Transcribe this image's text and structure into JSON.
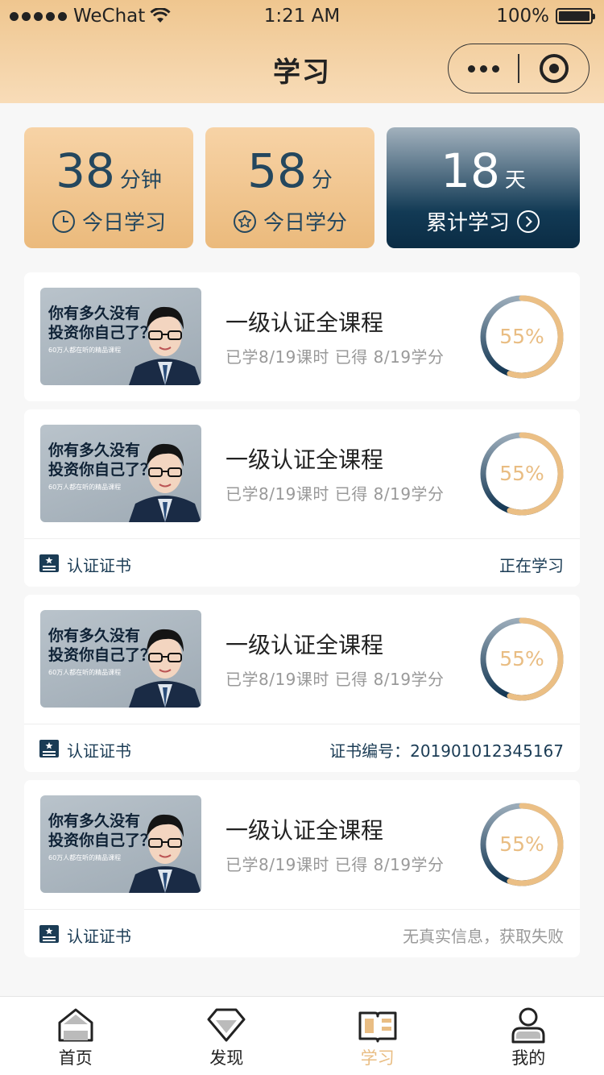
{
  "status_bar": {
    "carrier": "WeChat",
    "time": "1:21 AM",
    "battery": "100%"
  },
  "nav": {
    "title": "学习"
  },
  "stats": [
    {
      "value": "38",
      "unit": "分钟",
      "label": "今日学习",
      "icon": "clock-icon"
    },
    {
      "value": "58",
      "unit": "分",
      "label": "今日学分",
      "icon": "star-icon"
    },
    {
      "value": "18",
      "unit": "天",
      "label": "累计学习",
      "icon": "chevron-right-circle-icon"
    }
  ],
  "courses": [
    {
      "thumb_title_1": "你有多久没有",
      "thumb_title_2": "投资你自己了？",
      "thumb_sub": "60万人都在听的精品课程",
      "title": "一级认证全课程",
      "meta": "已学8/19课时 已得 8/19学分",
      "progress": 0.55,
      "progress_label": "55%"
    },
    {
      "thumb_title_1": "你有多久没有",
      "thumb_title_2": "投资你自己了？",
      "thumb_sub": "60万人都在听的精品课程",
      "title": "一级认证全课程",
      "meta": "已学8/19课时 已得 8/19学分",
      "progress": 0.55,
      "progress_label": "55%",
      "cert_label": "认证证书",
      "cert_status": "正在学习"
    },
    {
      "thumb_title_1": "你有多久没有",
      "thumb_title_2": "投资你自己了？",
      "thumb_sub": "60万人都在听的精品课程",
      "title": "一级认证全课程",
      "meta": "已学8/19课时 已得 8/19学分",
      "progress": 0.55,
      "progress_label": "55%",
      "cert_label": "认证证书",
      "cert_status": "证书编号：201901012345167"
    },
    {
      "thumb_title_1": "你有多久没有",
      "thumb_title_2": "投资你自己了？",
      "thumb_sub": "60万人都在听的精品课程",
      "title": "一级认证全课程",
      "meta": "已学8/19课时 已得 8/19学分",
      "progress": 0.55,
      "progress_label": "55%",
      "cert_label": "认证证书",
      "cert_status": "无真实信息，获取失败"
    }
  ],
  "tabs": [
    {
      "label": "首页",
      "icon": "home-icon"
    },
    {
      "label": "发现",
      "icon": "diamond-icon"
    },
    {
      "label": "学习",
      "icon": "book-icon",
      "active": true
    },
    {
      "label": "我的",
      "icon": "user-icon"
    }
  ],
  "colors": {
    "accent": "#e9bd83",
    "dark_blue": "#123a55",
    "gold_light": "#f7d3a6",
    "gold_dark": "#ebba7c"
  }
}
